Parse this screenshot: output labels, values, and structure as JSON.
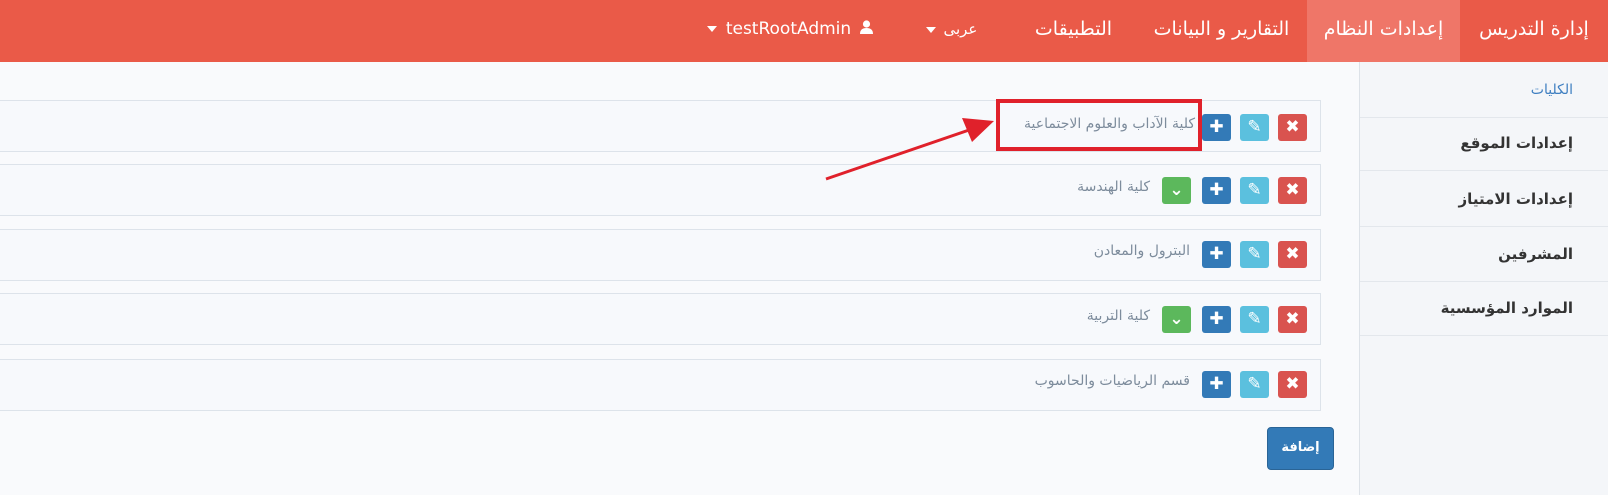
{
  "navbar": {
    "items": [
      {
        "label": "إدارة التدريس"
      },
      {
        "label": "إعدادات النظام"
      },
      {
        "label": "التقارير و البيانات"
      },
      {
        "label": "التطبيقات"
      },
      {
        "label": "عربى"
      },
      {
        "label": "testRootAdmin"
      }
    ],
    "accent_color": "#ea5a48",
    "active_color": "#ef7668"
  },
  "sidebar": {
    "items": [
      {
        "label": "الكليات"
      },
      {
        "label": "إعدادات الموقع"
      },
      {
        "label": "إعدادات الامتياز"
      },
      {
        "label": "المشرفين"
      },
      {
        "label": "الموارد المؤسسية"
      }
    ]
  },
  "list": {
    "rows": [
      {
        "label": "كلية الآداب والعلوم الاجتماعية",
        "has_check": false
      },
      {
        "label": "كلية الهندسة",
        "has_check": true
      },
      {
        "label": "البترول والمعادن",
        "has_check": false
      },
      {
        "label": "كلية التربية",
        "has_check": true
      },
      {
        "label": "قسم الرياضيات والحاسوب",
        "has_check": false
      }
    ],
    "icons": {
      "delete": "close-icon",
      "edit": "edit-icon",
      "add": "plus-icon",
      "check": "chevron-down-icon"
    }
  },
  "actions": {
    "add_label": "إضافة"
  },
  "annotation": {
    "highlight_color": "#e0212b"
  }
}
